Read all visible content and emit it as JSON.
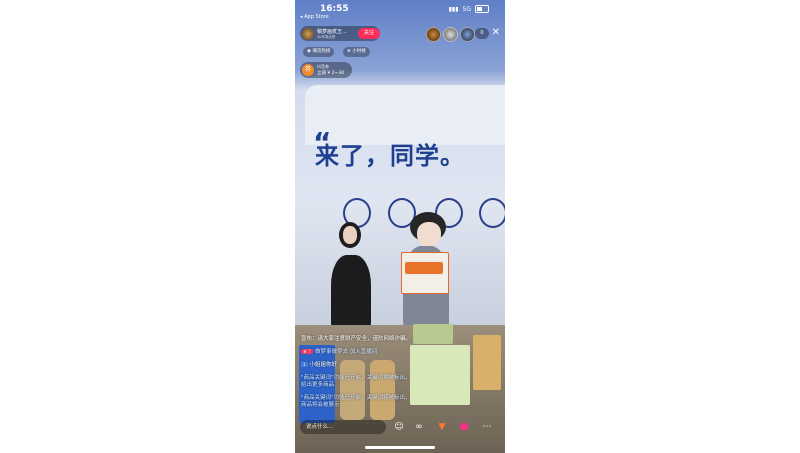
{
  "status": {
    "time": "16:55",
    "back_app": "◂ App Store",
    "network": "5G"
  },
  "host": {
    "name": "稿梦画贰王…",
    "sub": "4k本场点赞",
    "follow_label": "关注"
  },
  "viewer_count": "0",
  "pills": {
    "left": "◉ 潮流热榜",
    "right": "⊕ 小时榜"
  },
  "rank": {
    "icon": "券",
    "line1": "抖音券",
    "line2": "立减 ¥ 2~30"
  },
  "banner": {
    "quote": "“",
    "slogan": "来了，同学。"
  },
  "chat": {
    "messages": [
      {
        "text": "宣布：请大家注意财产安全，谨防网络诈骗。",
        "badge": "",
        "highlight": false
      },
      {
        "text": "做梦事做梦去 加入直播间",
        "badge": "来了",
        "highlight": true
      },
      {
        "text": "小姐姐你好",
        "badge": "1",
        "highlight": false
      },
      {
        "text": "\"商品关键词\"功能已开启，关键词将被标出，",
        "badge": "",
        "highlight": true
      },
      {
        "text": "给出更多商品",
        "badge": "",
        "highlight": true
      },
      {
        "text": "\"商品关键词\"功能已开启，关键词将被标出，",
        "badge": "",
        "highlight": true
      },
      {
        "text": "商品将会被展示",
        "badge": "",
        "highlight": true
      }
    ]
  },
  "bottom": {
    "say_placeholder": "说点什么…"
  },
  "colors": {
    "accent": "#ff2d5a",
    "brand_blue": "#1f3f91"
  },
  "icons": [
    "emoji-icon",
    "link-icon",
    "cart-icon",
    "gift-icon",
    "more-icon"
  ]
}
